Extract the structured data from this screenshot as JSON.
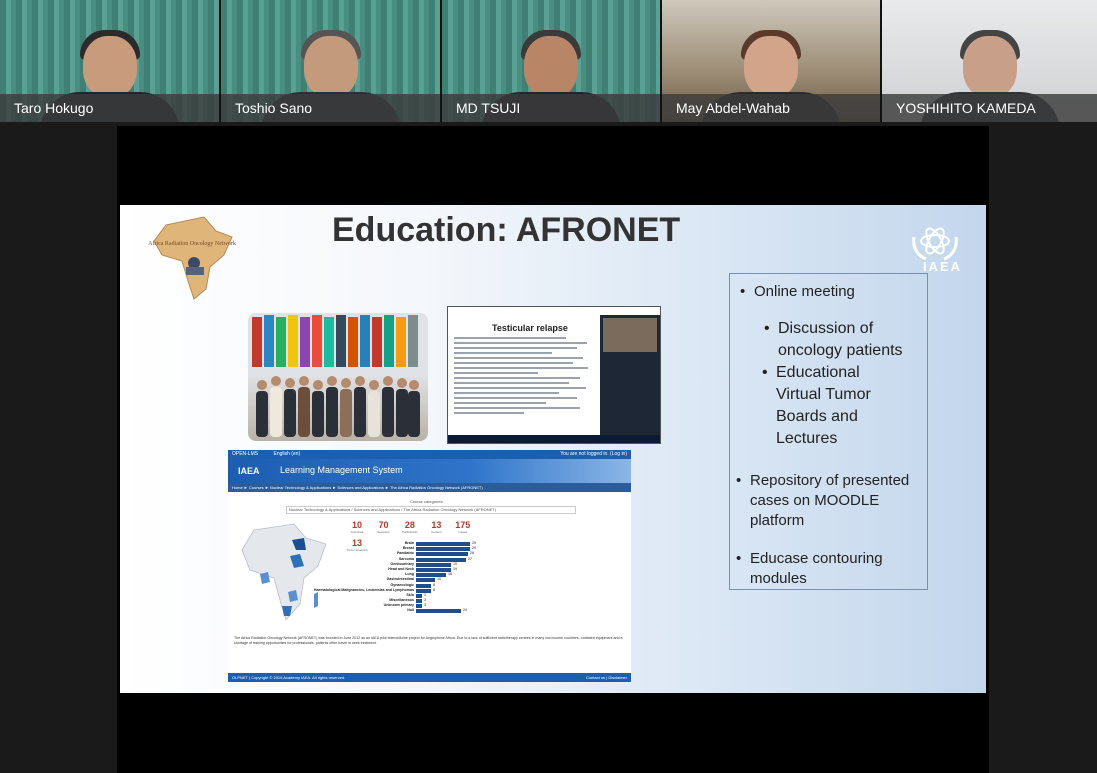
{
  "participants": [
    {
      "name": "Taro Hokugo"
    },
    {
      "name": "Toshio Sano"
    },
    {
      "name": "MD TSUJI"
    },
    {
      "name": "May Abdel-Wahab"
    },
    {
      "name": "YOSHIHITO KAMEDA"
    }
  ],
  "slide": {
    "title": "Education: AFRONET",
    "logo_text": "Africa Radiation Oncology Network",
    "iaea_label": "IAEA",
    "bullets": [
      {
        "text": "Online meeting"
      },
      {
        "text": "Discussion of oncology patients"
      },
      {
        "text": "Educational Virtual Tumor Boards and Lectures"
      },
      {
        "text": "Repository of presented cases on MOODLE platform"
      },
      {
        "text": "Educase contouring modules"
      }
    ]
  },
  "zoom_screenshot": {
    "title": "Testicular relapse"
  },
  "lms": {
    "top_left": "OPEN-LMS",
    "top_mid": "English (en)",
    "top_right": "You are not logged in. (Log in)",
    "iaea": "IAEA",
    "brand": "Learning Management System",
    "breadcrumb": "Home ► Courses ► Nuclear Technology & Applications ► Sciences and Applications ► The Africa Radiation Oncology Network (AFRONET)",
    "select_label": "Course categories:",
    "select_value": "Nuclear Technology & Applications / Sciences and Applications / The Africa Radiation Oncology Network (AFRONET)",
    "stats": [
      {
        "n": "10",
        "l": "Countries"
      },
      {
        "n": "70",
        "l": "Sessions"
      },
      {
        "n": "28",
        "l": "Participants"
      },
      {
        "n": "13",
        "l": "Centers"
      },
      {
        "n": "175",
        "l": "Cases"
      },
      {
        "n": "13",
        "l": "Tumor locations"
      }
    ],
    "bars": [
      {
        "label": "Brain",
        "value": 29
      },
      {
        "label": "Breast",
        "value": 29
      },
      {
        "label": "Paediatric",
        "value": 28
      },
      {
        "label": "Sarcoma",
        "value": 27
      },
      {
        "label": "Genitourinary",
        "value": 19
      },
      {
        "label": "Head and Neck",
        "value": 19
      },
      {
        "label": "Lung",
        "value": 16
      },
      {
        "label": "Gastrointestinal",
        "value": 10
      },
      {
        "label": "Gynaecologic",
        "value": 8
      },
      {
        "label": "Haematological Malignancies, Leukemias and Lymphomas",
        "value": 8
      },
      {
        "label": "Skin",
        "value": 3
      },
      {
        "label": "Miscellaneous",
        "value": 3
      },
      {
        "label": "Unknown primary",
        "value": 3
      },
      {
        "label": "Null",
        "value": 24
      }
    ],
    "description": "The Africa Radiation Oncology Network (AFRONET) was founded in June 2012 as an IAEA pilot telemedicine project for Anglophone Africa. Due to a lack of sufficient radiotherapy centres in many low income countries, outdated equipment and a shortage of training opportunities for professionals, patients often travel to seek treatment.",
    "footer_left": "OLPNET | Copyright © 2019 Academy IAEA. All rights reserved.",
    "footer_right": "Contact us | Disclaimer"
  },
  "colors": {
    "lms_blue": "#1b5fae",
    "stat_red": "#b33a2a",
    "bar_navy": "#1f4e8f"
  }
}
